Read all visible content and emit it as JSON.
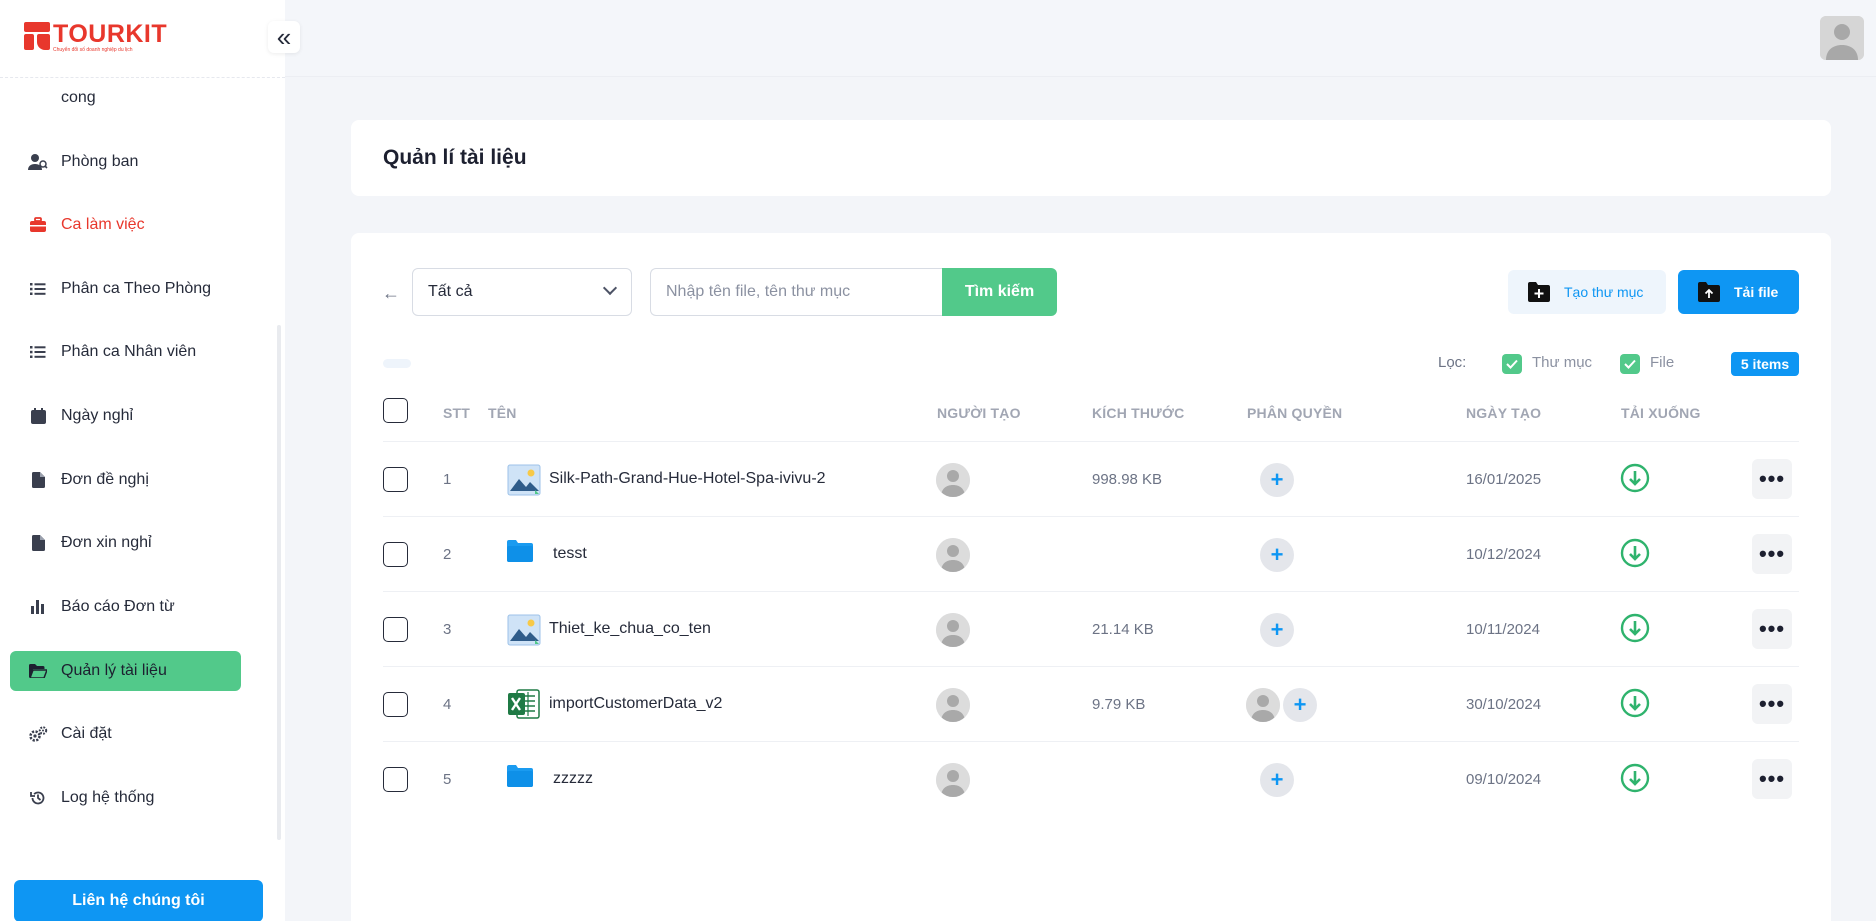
{
  "app": {
    "logo_name": "TOURKIT",
    "logo_tagline": "Chuyển đổi số doanh nghiệp du lịch",
    "brand_color": "#e8372c",
    "accent_green": "#52c98a",
    "accent_blue": "#0e96f3"
  },
  "sidebar": {
    "items": [
      {
        "label": "cong",
        "icon": "none"
      },
      {
        "label": "Phòng ban",
        "icon": "users-icon"
      },
      {
        "label": "Ca làm việc",
        "icon": "briefcase-icon"
      },
      {
        "label": "Phân ca Theo Phòng",
        "icon": "list-icon"
      },
      {
        "label": "Phân ca Nhân viên",
        "icon": "list-icon"
      },
      {
        "label": "Ngày nghỉ",
        "icon": "calendar-icon"
      },
      {
        "label": "Đơn đề nghị",
        "icon": "document-icon"
      },
      {
        "label": "Đơn xin nghỉ",
        "icon": "document-icon"
      },
      {
        "label": "Báo cáo Đơn từ",
        "icon": "bar-chart-icon"
      },
      {
        "label": "Quản lý tài liệu",
        "icon": "folder-open-icon",
        "active": true
      },
      {
        "label": "Cài đặt",
        "icon": "gears-icon"
      },
      {
        "label": "Log hệ thống",
        "icon": "history-icon"
      }
    ],
    "contact_label": "Liên hệ chúng tôi"
  },
  "page": {
    "title": "Quản lí tài liệu"
  },
  "toolbar": {
    "select_value": "Tất cả",
    "search_placeholder": "Nhập tên file, tên thư mục",
    "search_button": "Tìm kiếm",
    "new_folder_button": "Tạo thư mục",
    "upload_button": "Tải file"
  },
  "filters": {
    "label": "Lọc:",
    "folder_label": "Thư mục",
    "file_label": "File",
    "folder_checked": true,
    "file_checked": true,
    "items_badge": "5 items"
  },
  "table": {
    "columns": {
      "stt": "STT",
      "name": "TÊN",
      "creator": "NGƯỜI TẠO",
      "size": "KÍCH THƯỚC",
      "permission": "PHÂN QUYỀN",
      "created": "NGÀY TẠO",
      "download": "TẢI XUỐNG"
    },
    "rows": [
      {
        "stt": "1",
        "name": "Silk-Path-Grand-Hue-Hotel-Spa-ivivu-2",
        "type": "image-file-icon",
        "size": "998.98 KB",
        "shared_users": 0,
        "created": "16/01/2025"
      },
      {
        "stt": "2",
        "name": "tesst",
        "type": "folder-icon",
        "size": "",
        "shared_users": 0,
        "created": "10/12/2024"
      },
      {
        "stt": "3",
        "name": "Thiet_ke_chua_co_ten",
        "type": "image-file-icon",
        "size": "21.14 KB",
        "shared_users": 0,
        "created": "10/11/2024"
      },
      {
        "stt": "4",
        "name": "importCustomerData_v2",
        "type": "excel-file-icon",
        "size": "9.79 KB",
        "shared_users": 1,
        "created": "30/10/2024"
      },
      {
        "stt": "5",
        "name": "zzzzz",
        "type": "folder-icon",
        "size": "",
        "shared_users": 0,
        "created": "09/10/2024"
      }
    ]
  }
}
